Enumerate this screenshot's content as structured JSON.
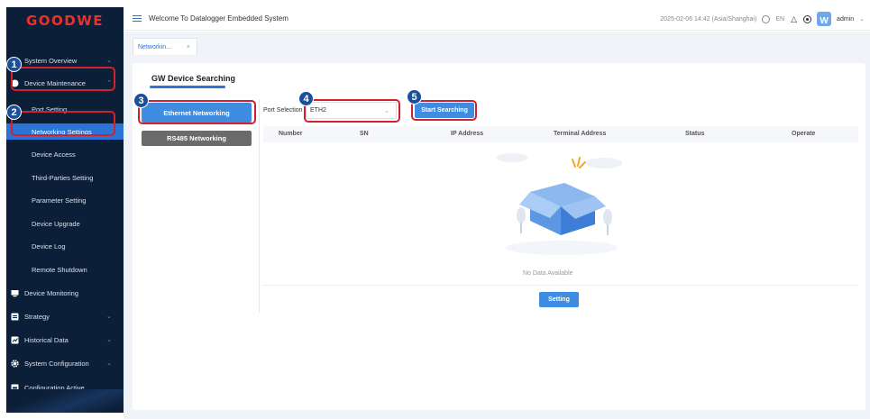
{
  "brand": {
    "logo": "GOODWE",
    "accent": "#2b74d6",
    "highlight": "#d0222e"
  },
  "header": {
    "title": "Welcome To Datalogger Embedded System",
    "datetime": "2025-02-06 14:42 (Asia/Shanghai)",
    "language": "EN",
    "user": "admin"
  },
  "tabs": [
    {
      "label": "Networkin...",
      "close": "×"
    }
  ],
  "sidebar": {
    "items": [
      {
        "label": "System Overview",
        "icon": "dashboard-icon",
        "chevron": "⌄"
      },
      {
        "label": "Device Maintenance",
        "icon": "wrench-icon",
        "chevron": "⌃"
      },
      {
        "label": "Device Monitoring",
        "icon": "monitor-icon"
      },
      {
        "label": "Strategy",
        "icon": "strategy-icon",
        "chevron": "⌄"
      },
      {
        "label": "Historical Data",
        "icon": "history-icon",
        "chevron": "⌄"
      },
      {
        "label": "System Configuration",
        "icon": "gear-icon",
        "chevron": "⌄"
      },
      {
        "label": "Configuration Active",
        "icon": "config-icon"
      }
    ],
    "subitems": [
      {
        "label": "Port Setting"
      },
      {
        "label": "Networking Settings"
      },
      {
        "label": "Device Access"
      },
      {
        "label": "Third-Parties Setting"
      },
      {
        "label": "Parameter Setting"
      },
      {
        "label": "Device Upgrade"
      },
      {
        "label": "Device Log"
      },
      {
        "label": "Remote Shutdown"
      }
    ]
  },
  "main": {
    "section_title": "GW Device Searching",
    "ethernet_button": "Ethernet Networking",
    "rs485_button": "RS485 Networking",
    "port_label": "Port Selection",
    "port_value": "ETH2",
    "start_button": "Start Searching",
    "columns": [
      "Number",
      "SN",
      "IP Address",
      "Terminal Address",
      "Status",
      "Operate"
    ],
    "empty_text": "No Data Available",
    "setting_button": "Setting"
  },
  "badges": [
    "1",
    "2",
    "3",
    "4",
    "5"
  ]
}
